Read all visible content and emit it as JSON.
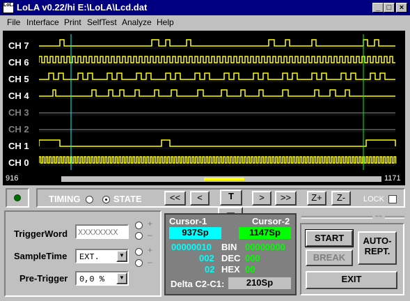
{
  "title": {
    "text": "LoLA v0.22/hi  E:\\LoLA\\Lcd.dat",
    "app_icon": "LoLA"
  },
  "menu": [
    "File",
    "Interface",
    "Print",
    "SelfTest",
    "Analyze",
    "Help"
  ],
  "channels": [
    {
      "label": "CH 7",
      "active": true
    },
    {
      "label": "CH 6",
      "active": true
    },
    {
      "label": "CH 5",
      "active": true
    },
    {
      "label": "CH 4",
      "active": true
    },
    {
      "label": "CH 3",
      "active": false
    },
    {
      "label": "CH 2",
      "active": false
    },
    {
      "label": "CH 1",
      "active": true
    },
    {
      "label": "CH 0",
      "active": true
    }
  ],
  "scope": {
    "range_start": "916",
    "range_end": "1171"
  },
  "controls": {
    "timing_label": "TIMING",
    "state_label": "STATE",
    "mode_selected": "STATE",
    "nav_first": "<<",
    "nav_prev": "<",
    "nav_t": "T",
    "nav_next": ">",
    "nav_last": ">>",
    "zoom_in": "Z+",
    "zoom_out": "Z-",
    "lock_label": "LOCK"
  },
  "trigger": {
    "trigger_word_label": "TriggerWord",
    "trigger_word_value": "XXXXXXXX",
    "sample_time_label": "SampleTime",
    "sample_time_value": "EXT.",
    "pre_trigger_label": "Pre-Trigger",
    "pre_trigger_value": "0,0 %",
    "plus": "+",
    "minus": "–"
  },
  "cursors": {
    "c1_label": "Cursor-1",
    "c2_label": "Cursor-2",
    "c1_value": "937Sp",
    "c2_value": "1147Sp",
    "bin_label": "BIN",
    "dec_label": "DEC",
    "hex_label": "HEX",
    "c1_bin": "00000010",
    "c2_bin": "00000000",
    "c1_dec": "002",
    "c2_dec": "000",
    "c1_hex": "02",
    "c2_hex": "00",
    "delta_label": "Delta C2-C1:",
    "delta_value": "210Sp",
    "c1_color": "#00ffff",
    "c2_color": "#00ff00"
  },
  "actions": {
    "start": "START",
    "break": "BREAK",
    "auto": "AUTO-",
    "rept": "REPT.",
    "exit": "EXIT"
  },
  "colors": {
    "trace": "#ffff00",
    "cursor1": "#00ffff",
    "cursor2": "#00ff00",
    "marker": "#ff0000"
  }
}
